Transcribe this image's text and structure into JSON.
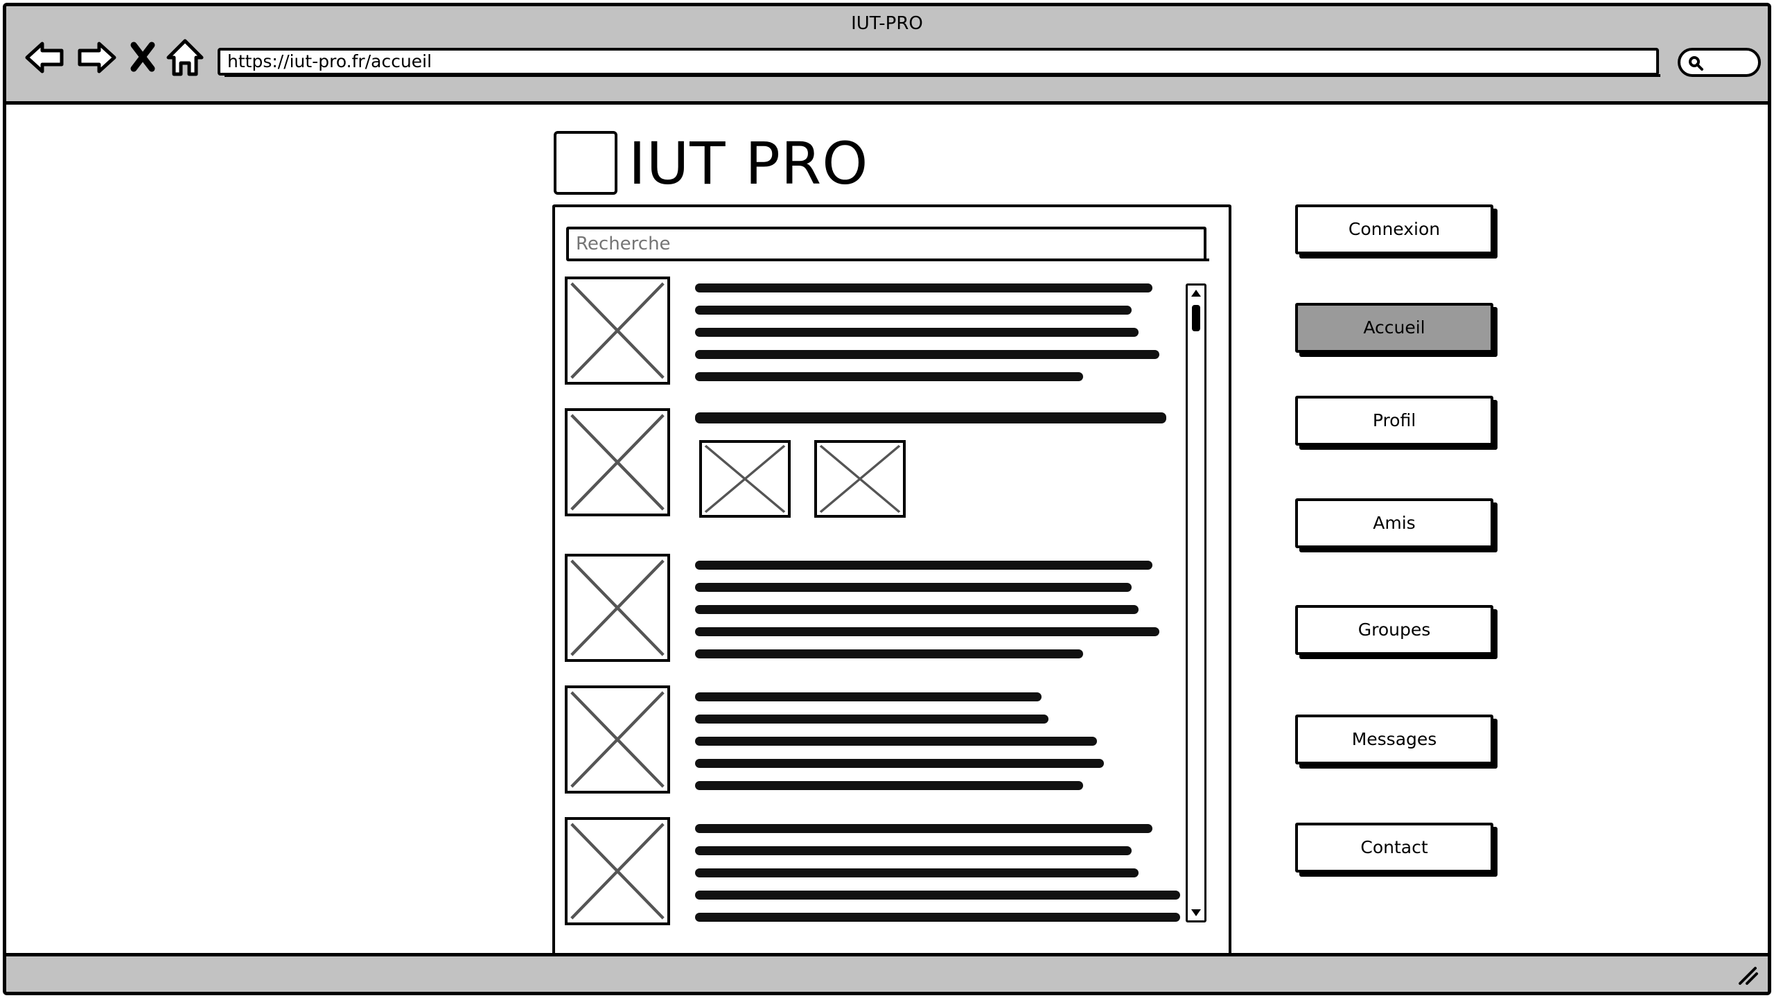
{
  "window": {
    "title": "IUT-PRO"
  },
  "browser": {
    "url": "https://iut-pro.fr/accueil",
    "icons": [
      "back-arrow-icon",
      "forward-arrow-icon",
      "stop-icon",
      "home-icon",
      "search-icon"
    ]
  },
  "header": {
    "title": "IUT PRO"
  },
  "search": {
    "placeholder": "Recherche"
  },
  "menu": {
    "items": [
      {
        "label": "Connexion",
        "active": false
      },
      {
        "label": "Accueil",
        "active": true
      },
      {
        "label": "Profil",
        "active": false
      },
      {
        "label": "Amis",
        "active": false
      },
      {
        "label": "Groupes",
        "active": false
      },
      {
        "label": "Messages",
        "active": false
      },
      {
        "label": "Contact",
        "active": false
      }
    ]
  },
  "colors": {
    "chrome": "#c2c2c2",
    "active_button": "#9a9a9a"
  }
}
